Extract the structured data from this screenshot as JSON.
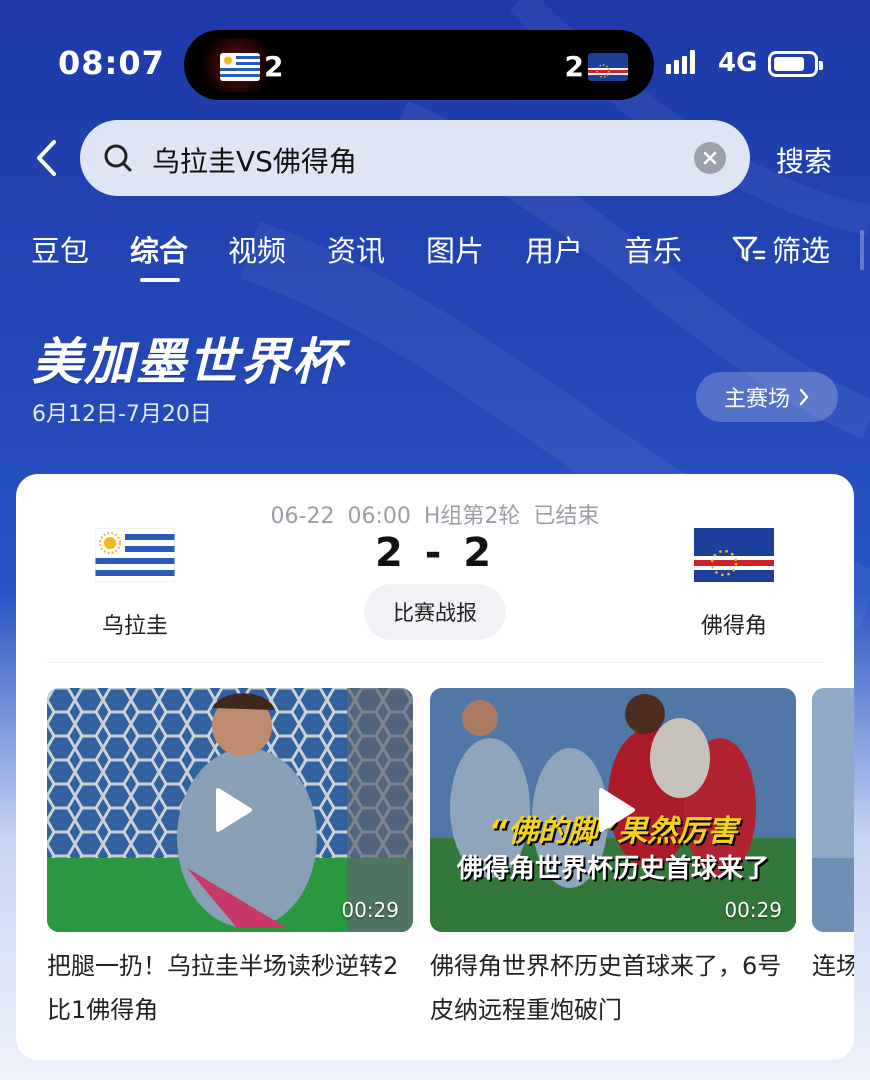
{
  "status_bar": {
    "time": "08:07",
    "live_home_score": "2",
    "live_away_score": "2",
    "network": "4G"
  },
  "search": {
    "query": "乌拉圭VS佛得角",
    "search_label": "搜索"
  },
  "tabs": [
    {
      "label": "豆包"
    },
    {
      "label": "综合",
      "active": true
    },
    {
      "label": "视频"
    },
    {
      "label": "资讯"
    },
    {
      "label": "图片"
    },
    {
      "label": "用户"
    },
    {
      "label": "音乐"
    }
  ],
  "filter_label": "筛选",
  "event": {
    "title": "美加墨世界杯",
    "dates": "6月12日-7月20日",
    "venue_label": "主赛场"
  },
  "match": {
    "datetime": "06-22 06:00",
    "group_round": "H组第2轮",
    "status": "已结束",
    "home_team": "乌拉圭",
    "away_team": "佛得角",
    "score": "2 - 2",
    "report_label": "比赛战报"
  },
  "videos": [
    {
      "duration": "00:29",
      "title": "把腿一扔！乌拉圭半场读秒逆转2比1佛得角"
    },
    {
      "duration": "00:29",
      "overlay_line1": "“佛的脚”果然厉害",
      "overlay_line2": "佛得角世界杯历史首球来了",
      "title": "佛得角世界杯历史首球来了，6号皮纳远程重炮破门"
    },
    {
      "title": "连场补射"
    }
  ],
  "colors": {
    "brand_blue": "#2448b8",
    "uruguay_blue": "#2a5bb8",
    "cape_verde_blue": "#1b3f9a",
    "cape_verde_red": "#d21f2c"
  }
}
